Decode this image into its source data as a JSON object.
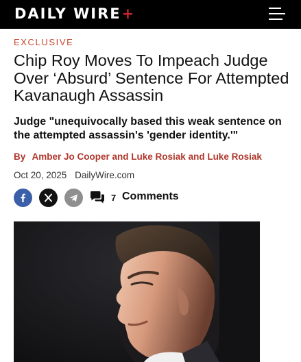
{
  "header": {
    "logo_text": "DAILY WIRE",
    "logo_plus": "+",
    "menu_icon": "hamburger-menu-icon"
  },
  "article": {
    "kicker": "EXCLUSIVE",
    "headline": "Chip Roy Moves To Impeach Judge Over ‘Absurd’ Sentence For Attempted Kavanaugh Assassin",
    "subheadline": "Judge \"unequivocally based this weak sentence on the attempted assassin's 'gender identity.'\"",
    "byline_prefix": "By",
    "authors": "Amber Jo Cooper and Luke Rosiak and Luke Rosiak",
    "date": "Oct 20, 2025",
    "site": "DailyWire.com"
  },
  "share": {
    "icons": [
      "facebook-icon",
      "x-icon",
      "telegram-icon"
    ],
    "comment_count": "7",
    "comment_label": "Comments"
  },
  "colors": {
    "accent": "#d0202e",
    "kicker": "#c8452f",
    "byline": "#b0372c",
    "facebook": "#3b5fa8",
    "telegram": "#8f8f8f"
  }
}
